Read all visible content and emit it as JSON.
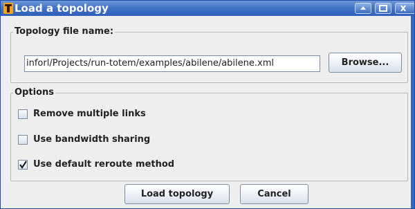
{
  "window": {
    "title": "Load a topology",
    "controls": {
      "minimize": "minimize-icon",
      "maximize": "maximize-icon",
      "close": "close-icon"
    },
    "colors": {
      "titlebar": "#3f6fc4",
      "edge": "#3667bf"
    }
  },
  "file_group": {
    "legend": "Topology file name:",
    "path_value": "inforl/Projects/run-totem/examples/abilene/abilene.xml",
    "browse_label": "Browse..."
  },
  "options_group": {
    "legend": "Options",
    "options": [
      {
        "label": "Remove multiple links",
        "checked": false
      },
      {
        "label": "Use bandwidth sharing",
        "checked": false
      },
      {
        "label": "Use default reroute method",
        "checked": true
      }
    ]
  },
  "buttons": {
    "load_label": "Load topology",
    "cancel_label": "Cancel"
  }
}
